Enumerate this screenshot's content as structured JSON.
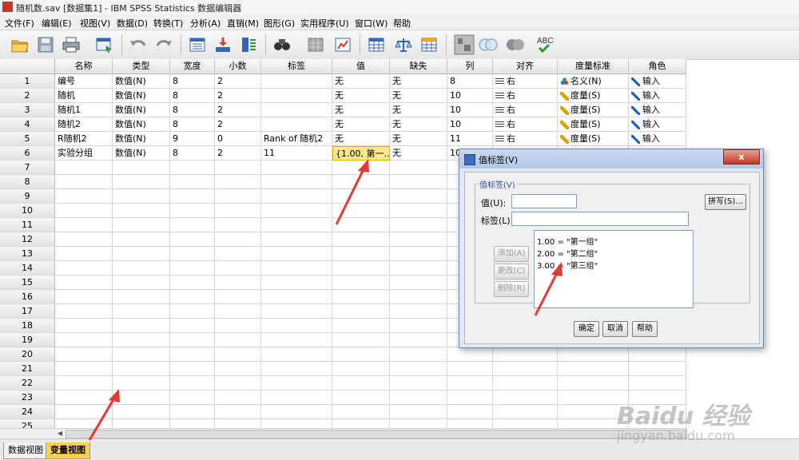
{
  "window": {
    "title": "随机数.sav [数据集1] - IBM SPSS Statistics 数据编辑器"
  },
  "menu": [
    "文件(F)",
    "编辑(E)",
    "视图(V)",
    "数据(D)",
    "转换(T)",
    "分析(A)",
    "直销(M)",
    "图形(G)",
    "实用程序(U)",
    "窗口(W)",
    "帮助"
  ],
  "toolbar": {
    "icons": [
      "open-folder-icon",
      "save-icon",
      "print-icon",
      "dialog-recall-icon",
      "undo-icon",
      "redo-icon",
      "goto-case-icon",
      "goto-variable-icon",
      "variables-icon",
      "find-icon",
      "insert-cases-icon",
      "insert-variable-icon",
      "split-file-icon",
      "weight-cases-icon",
      "select-cases-icon",
      "value-labels-icon",
      "use-sets-icon",
      "show-all-variables-icon",
      "spell-check-icon"
    ],
    "spell_check_label": "ABC"
  },
  "grid": {
    "columns": [
      "名称",
      "类型",
      "宽度",
      "小数",
      "标签",
      "值",
      "缺失",
      "列",
      "对齐",
      "度量标准",
      "角色"
    ],
    "rows": [
      {
        "num": "1",
        "name": "编号",
        "type": "数值(N)",
        "width": "8",
        "decimals": "2",
        "label": "",
        "values": "无",
        "missing": "无",
        "columns": "8",
        "align": "右",
        "measure": "名义(N)",
        "role": "输入"
      },
      {
        "num": "2",
        "name": "随机",
        "type": "数值(N)",
        "width": "8",
        "decimals": "2",
        "label": "",
        "values": "无",
        "missing": "无",
        "columns": "10",
        "align": "右",
        "measure": "度量(S)",
        "role": "输入"
      },
      {
        "num": "3",
        "name": "随机1",
        "type": "数值(N)",
        "width": "8",
        "decimals": "2",
        "label": "",
        "values": "无",
        "missing": "无",
        "columns": "10",
        "align": "右",
        "measure": "度量(S)",
        "role": "输入"
      },
      {
        "num": "4",
        "name": "随机2",
        "type": "数值(N)",
        "width": "8",
        "decimals": "2",
        "label": "",
        "values": "无",
        "missing": "无",
        "columns": "10",
        "align": "右",
        "measure": "度量(S)",
        "role": "输入"
      },
      {
        "num": "5",
        "name": "R随机2",
        "type": "数值(N)",
        "width": "9",
        "decimals": "0",
        "label": "Rank of 随机2",
        "values": "无",
        "missing": "无",
        "columns": "11",
        "align": "右",
        "measure": "度量(S)",
        "role": "输入"
      },
      {
        "num": "6",
        "name": "实验分组",
        "type": "数值(N)",
        "width": "8",
        "decimals": "2",
        "label": "11",
        "values": "{1.00, 第一...",
        "missing": "无",
        "columns": "10",
        "align": "",
        "measure": "",
        "role": ""
      }
    ],
    "empty_row_numbers": [
      "7",
      "8",
      "9",
      "10",
      "11",
      "12",
      "13",
      "14",
      "15",
      "16",
      "17",
      "18",
      "19",
      "20",
      "21",
      "22",
      "23",
      "24",
      "25"
    ]
  },
  "tabs": {
    "data_view": "数据视图",
    "variable_view": "变量视图"
  },
  "dialog": {
    "title": "值标签(V)",
    "close": "x",
    "group_label": "值标签(V)",
    "value_label": "值(U):",
    "label_label": "标签(L):",
    "value_input": "",
    "label_input": "",
    "spelling_button": "拼写(S)...",
    "add_button": "添加(A)",
    "change_button": "更改(C)",
    "remove_button": "删除(R)",
    "list_items": [
      "1.00 = \"第一组\"",
      "2.00 = \"第二组\"",
      "3.00 = \"第三组\""
    ],
    "ok_button": "确定",
    "cancel_button": "取消",
    "help_button": "帮助"
  },
  "watermark": {
    "brand": "Baidu 经验",
    "url": "jingyan.baidu.com"
  },
  "colors": {
    "highlight_cell": "#ffe88c",
    "active_tab": "#ffd24d",
    "annotation_arrow": "#e53935"
  }
}
